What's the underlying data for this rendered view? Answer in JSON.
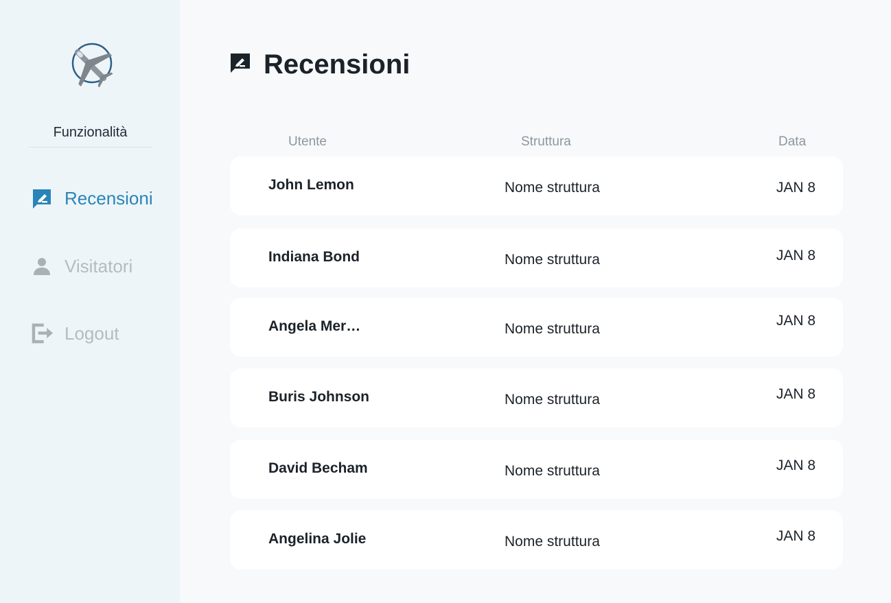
{
  "sidebar": {
    "logo": "airplane-logo",
    "section_title": "Funzionalità",
    "items": [
      {
        "label": "Recensioni",
        "icon": "review-edit-icon",
        "active": true
      },
      {
        "label": "Visitatori",
        "icon": "person-icon",
        "active": false
      },
      {
        "label": "Logout",
        "icon": "logout-icon",
        "active": false
      }
    ]
  },
  "main": {
    "title": "Recensioni",
    "title_icon": "review-edit-icon",
    "columns": {
      "user": "Utente",
      "structure": "Struttura",
      "date": "Data"
    },
    "rows": [
      {
        "user": "John Lemon",
        "structure": "Nome struttura",
        "date": "JAN 8"
      },
      {
        "user": "Indiana Bond",
        "structure": "Nome struttura",
        "date": "JAN 8"
      },
      {
        "user": "Angela Merkel",
        "structure": "Nome struttura",
        "date": "JAN 8"
      },
      {
        "user": "Buris Johnson",
        "structure": "Nome struttura",
        "date": "JAN 8"
      },
      {
        "user": "David Becham",
        "structure": "Nome struttura",
        "date": "JAN 8"
      },
      {
        "user": "Angelina Jolie",
        "structure": "Nome struttura",
        "date": "JAN 8"
      }
    ]
  },
  "colors": {
    "accent": "#2a84b8",
    "sidebar_bg": "#edf5f8",
    "inactive": "#b4bcc1",
    "text": "#1b2229"
  }
}
